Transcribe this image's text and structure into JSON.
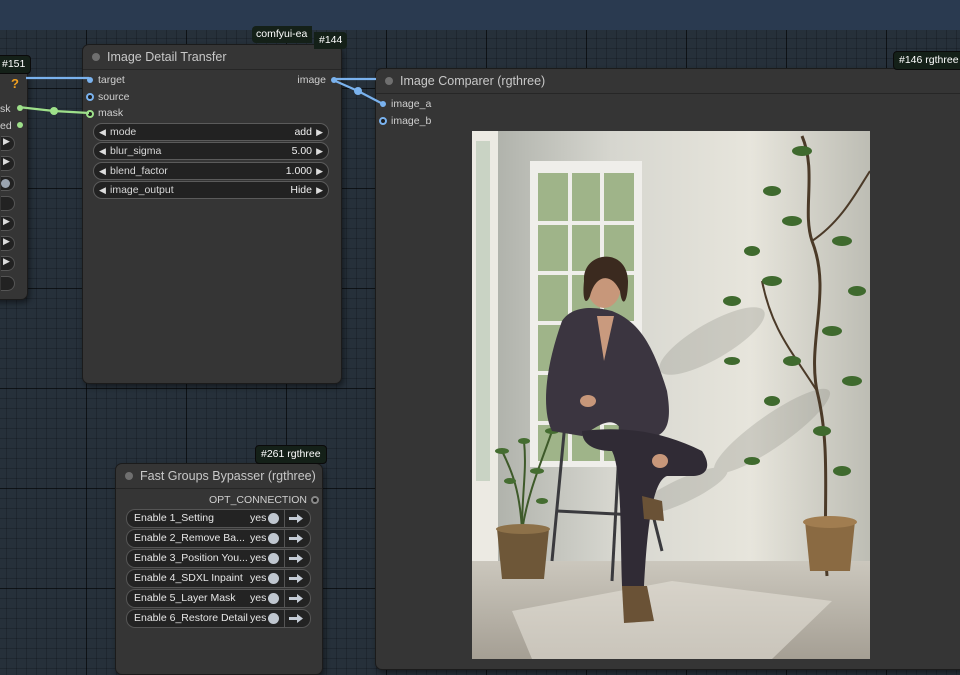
{
  "colors": {
    "canvas": "#26303a",
    "node_bg": "#353535",
    "topbar": "#2a3a50",
    "link_blue": "#7ab2ee",
    "link_green": "#9ee08a"
  },
  "left_node": {
    "badge": "#151",
    "warning": "?",
    "slot_mask": "sk",
    "slot_second": "ed"
  },
  "detail_node": {
    "badge": "comfyui-ea",
    "badge_id": "#144",
    "title": "Image Detail Transfer",
    "inputs": [
      "target",
      "source",
      "mask"
    ],
    "output": "image",
    "widgets": [
      {
        "name": "mode",
        "value": "add"
      },
      {
        "name": "blur_sigma",
        "value": "5.00"
      },
      {
        "name": "blend_factor",
        "value": "1.000"
      },
      {
        "name": "image_output",
        "value": "Hide"
      }
    ]
  },
  "comparer_node": {
    "badge": "#146 rgthree",
    "title": "Image Comparer (rgthree)",
    "inputs": [
      "image_a",
      "image_b"
    ]
  },
  "bypasser_node": {
    "badge": "#261 rgthree",
    "title": "Fast Groups Bypasser (rgthree)",
    "output": "OPT_CONNECTION",
    "rows": [
      {
        "label": "Enable 1_Setting",
        "state": "yes"
      },
      {
        "label": "Enable 2_Remove Ba...",
        "state": "yes"
      },
      {
        "label": "Enable 3_Position You...",
        "state": "yes"
      },
      {
        "label": "Enable 4_SDXL Inpaint",
        "state": "yes"
      },
      {
        "label": "Enable 5_Layer Mask",
        "state": "yes"
      },
      {
        "label": "Enable 6_Restore Detail",
        "state": "yes"
      }
    ]
  },
  "icons": [
    "play-arrow-icon",
    "left-arrow-icon",
    "right-arrow-icon",
    "node-status-dot-icon",
    "warning-icon"
  ]
}
